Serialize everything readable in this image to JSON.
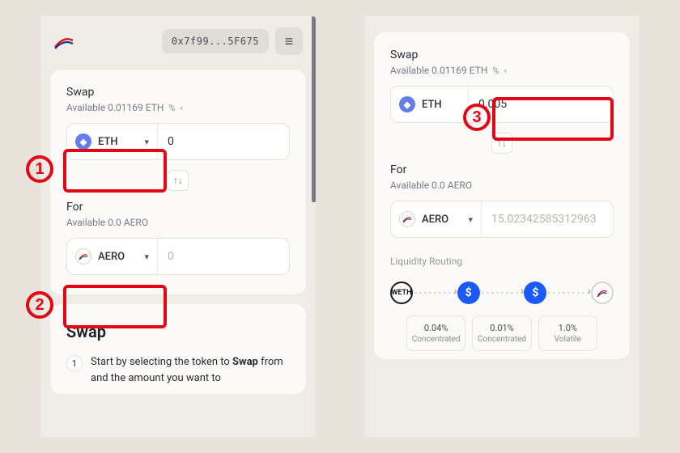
{
  "header": {
    "address": "0x7f99...5F675"
  },
  "left": {
    "swap": {
      "title": "Swap",
      "available": "Available 0.01169 ETH",
      "from_token": "ETH",
      "from_amount": "0",
      "for_label": "For",
      "for_available": "Available 0.0 AERO",
      "to_token": "AERO",
      "to_amount": "0"
    },
    "info": {
      "title": "Swap",
      "step_num": "1",
      "step_text_a": "Start by selecting the token to ",
      "step_text_bold": "Swap",
      "step_text_b": " from and the amount you want to"
    }
  },
  "right": {
    "swap": {
      "title": "Swap",
      "available": "Available 0.01169 ETH",
      "from_token": "ETH",
      "from_amount": "0.005",
      "for_label": "For",
      "for_available": "Available 0.0 AERO",
      "to_token": "AERO",
      "to_amount_placeholder": "15.02342585312963"
    },
    "routing": {
      "title": "Liquidity Routing",
      "nodes": {
        "weth": "WETH"
      },
      "pools": [
        {
          "pct": "0.04%",
          "type": "Concentrated"
        },
        {
          "pct": "0.01%",
          "type": "Concentrated"
        },
        {
          "pct": "1.0%",
          "type": "Volatile"
        }
      ]
    }
  },
  "callouts": {
    "one": "1",
    "two": "2",
    "three": "3"
  }
}
